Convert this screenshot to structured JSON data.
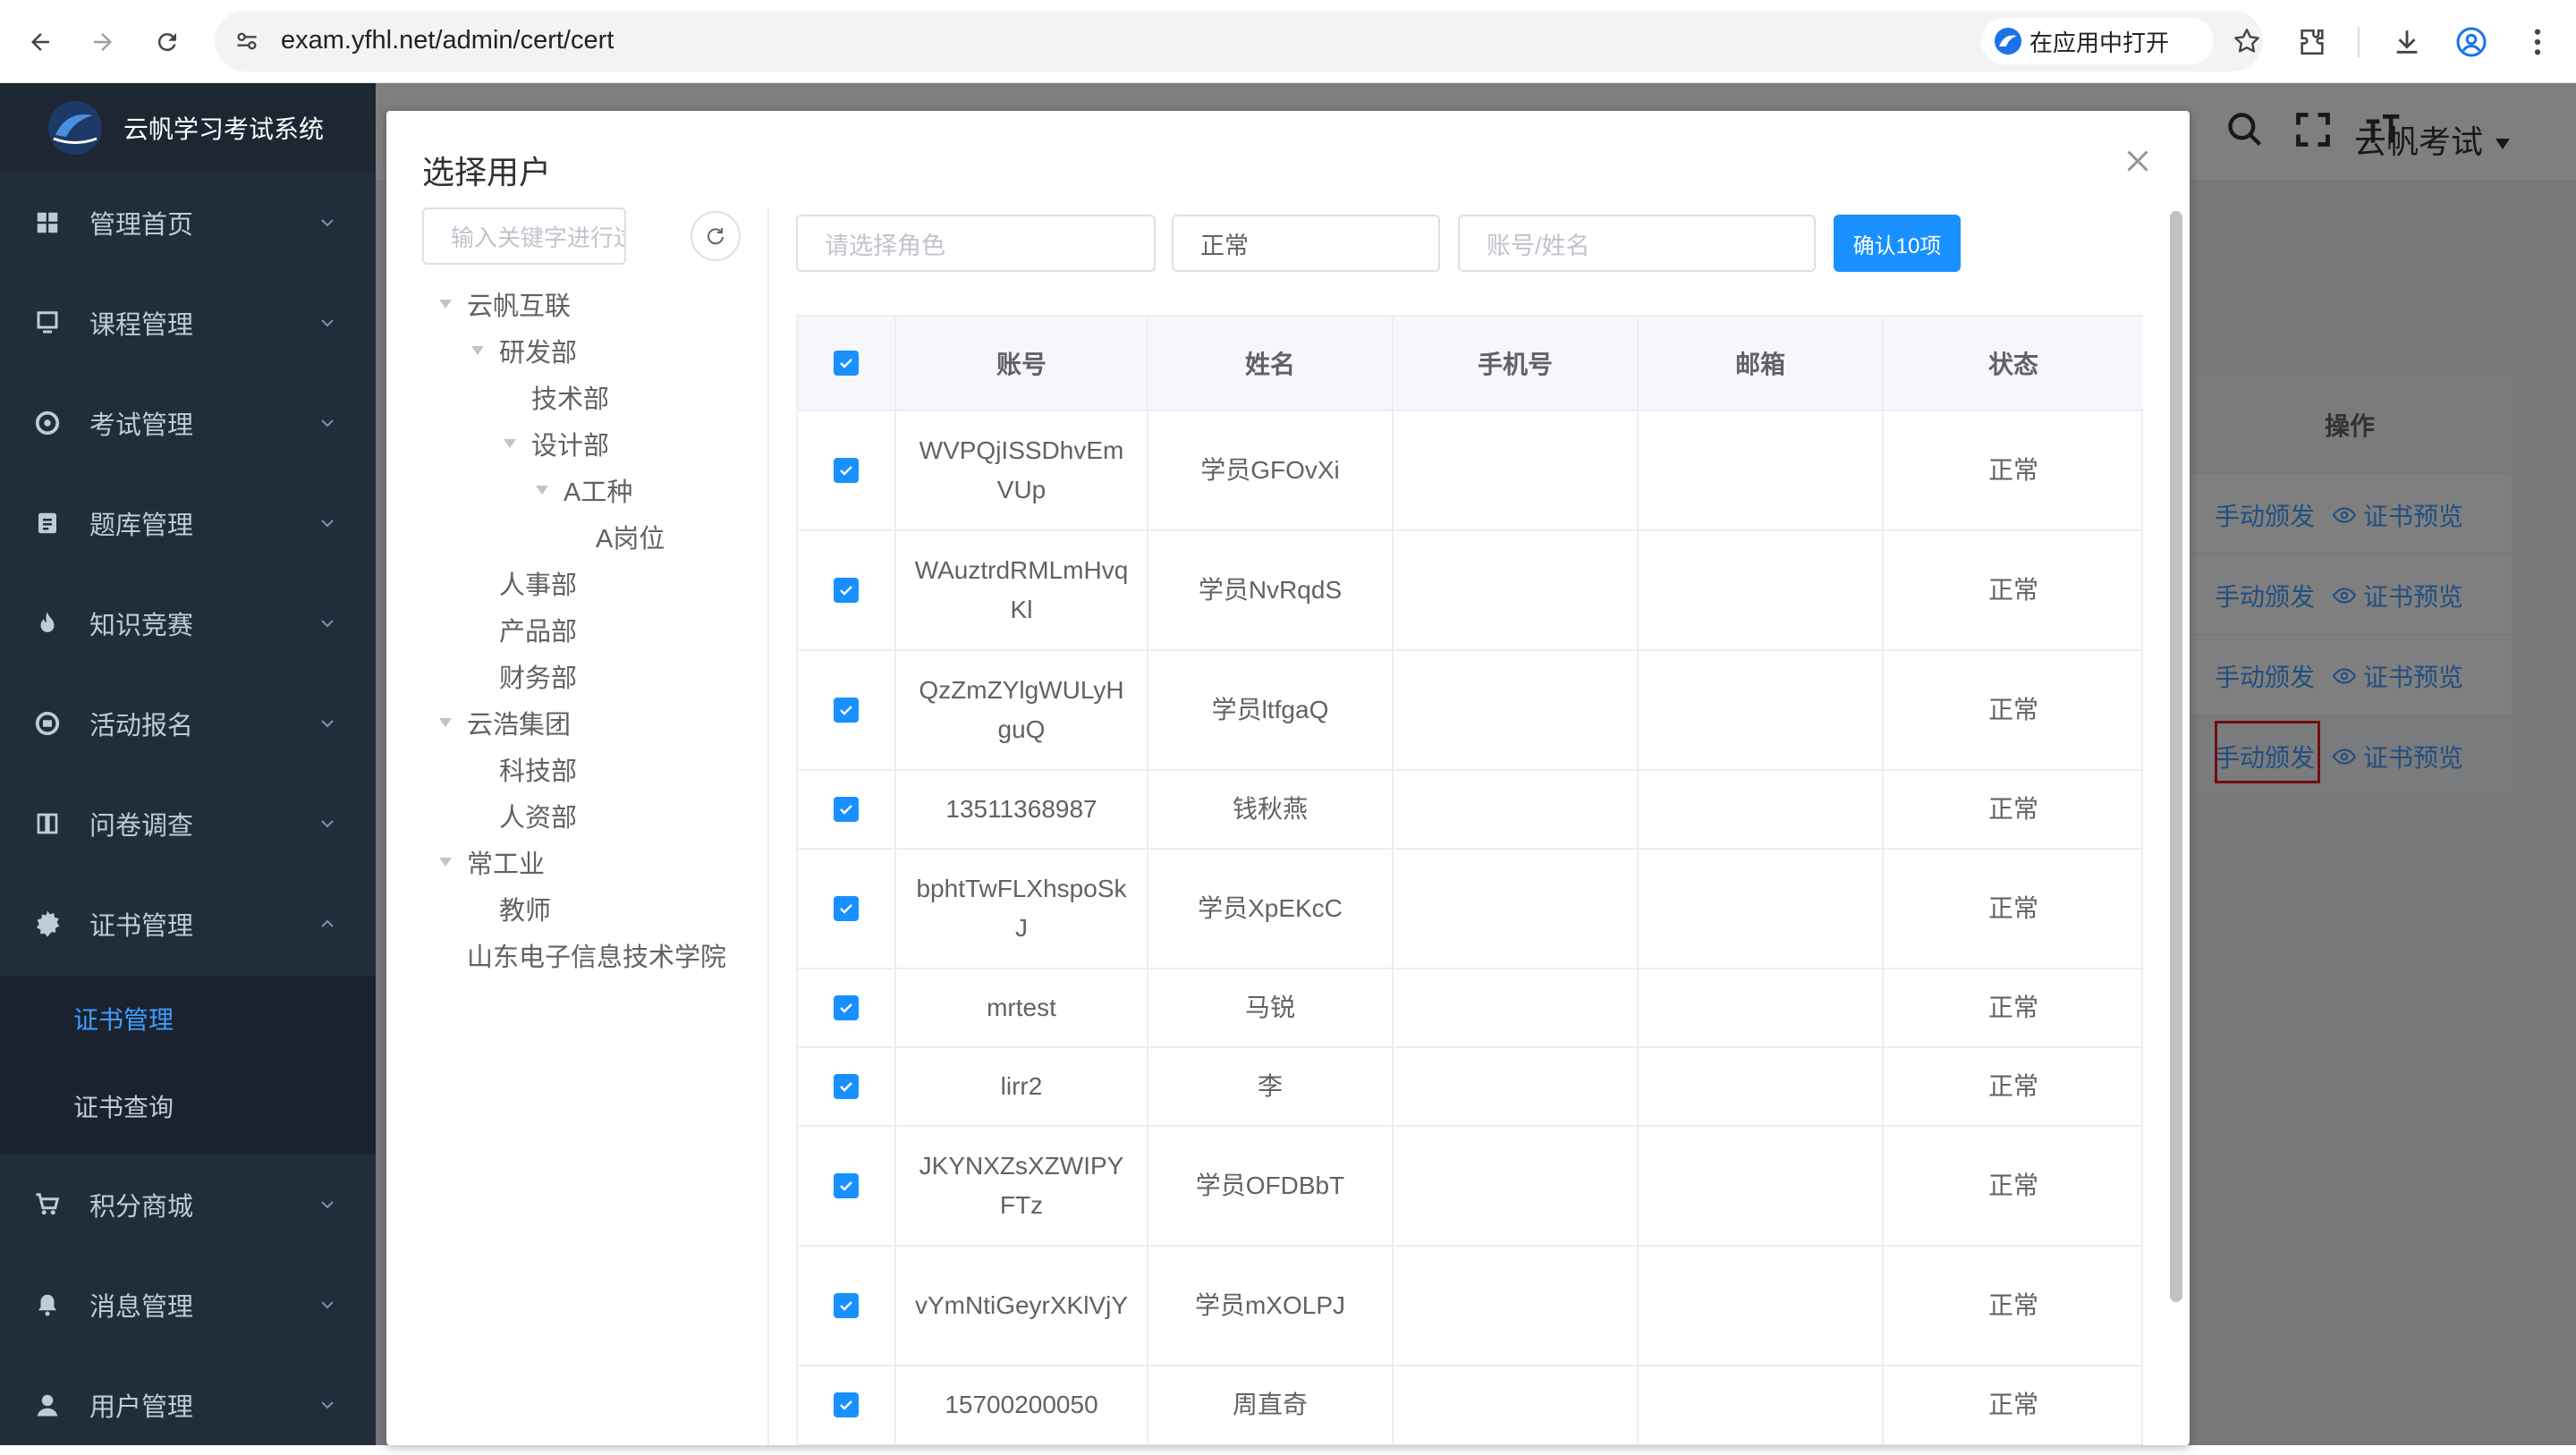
{
  "browser": {
    "url": "exam.yfhl.net/admin/cert/cert",
    "open_in_app": "在应用中打开"
  },
  "app": {
    "logo_text": "云帆学习考试系统",
    "user_name": "云帆考试"
  },
  "sidebar": {
    "items": [
      {
        "label": "管理首页",
        "icon": "dashboard-icon"
      },
      {
        "label": "课程管理",
        "icon": "monitor-icon"
      },
      {
        "label": "考试管理",
        "icon": "aperture-icon"
      },
      {
        "label": "题库管理",
        "icon": "document-icon"
      },
      {
        "label": "知识竞赛",
        "icon": "fire-icon"
      },
      {
        "label": "活动报名",
        "icon": "activity-icon"
      },
      {
        "label": "问卷调查",
        "icon": "book-icon"
      },
      {
        "label": "证书管理",
        "icon": "gear-icon"
      },
      {
        "label": "积分商城",
        "icon": "cart-icon"
      },
      {
        "label": "消息管理",
        "icon": "bell-icon"
      },
      {
        "label": "用户管理",
        "icon": "user-icon"
      }
    ],
    "submenu": [
      "证书管理",
      "证书查询"
    ]
  },
  "background_table": {
    "ops_header": "操作",
    "manual_issue": "手动颁发",
    "preview": "证书预览"
  },
  "dialog": {
    "title": "选择用户",
    "tree_filter_placeholder": "输入关键字进行过滤",
    "tree": [
      {
        "label": "云帆互联",
        "expanded": true
      },
      {
        "label": "研发部",
        "expanded": true
      },
      {
        "label": "技术部"
      },
      {
        "label": "设计部",
        "expanded": true
      },
      {
        "label": "A工种",
        "expanded": true
      },
      {
        "label": "A岗位"
      },
      {
        "label": "人事部"
      },
      {
        "label": "产品部"
      },
      {
        "label": "财务部"
      },
      {
        "label": "云浩集团",
        "expanded": true
      },
      {
        "label": "科技部"
      },
      {
        "label": "人资部"
      },
      {
        "label": "常工业",
        "expanded": true
      },
      {
        "label": "教师"
      },
      {
        "label": "山东电子信息技术学院"
      }
    ],
    "role_placeholder": "请选择角色",
    "status_value": "正常",
    "search_placeholder": "账号/姓名",
    "confirm_label": "确认10项",
    "columns": [
      "账号",
      "姓名",
      "手机号",
      "邮箱",
      "状态"
    ],
    "rows": [
      {
        "account": "WVPQjISSDhvEmVUp",
        "name": "学员GFOvXi",
        "phone": "",
        "email": "",
        "status": "正常"
      },
      {
        "account": "WAuztrdRMLmHvqKl",
        "name": "学员NvRqdS",
        "phone": "",
        "email": "",
        "status": "正常"
      },
      {
        "account": "QzZmZYlgWULyHguQ",
        "name": "学员ltfgaQ",
        "phone": "",
        "email": "",
        "status": "正常"
      },
      {
        "account": "13511368987",
        "name": "钱秋燕",
        "phone": "",
        "email": "",
        "status": "正常"
      },
      {
        "account": "bphtTwFLXhspoSkJ",
        "name": "学员XpEKcC",
        "phone": "",
        "email": "",
        "status": "正常"
      },
      {
        "account": "mrtest",
        "name": "马锐",
        "phone": "",
        "email": "",
        "status": "正常"
      },
      {
        "account": "lirr2",
        "name": "李",
        "phone": "",
        "email": "",
        "status": "正常"
      },
      {
        "account": "JKYNXZsXZWIPYFTz",
        "name": "学员OFDBbT",
        "phone": "",
        "email": "",
        "status": "正常"
      },
      {
        "account": "vYmNtiGeyrXKlVjY",
        "name": "学员mXOLPJ",
        "phone": "",
        "email": "",
        "status": "正常"
      },
      {
        "account": "15700200050",
        "name": "周直奇",
        "phone": "",
        "email": "",
        "status": "正常"
      }
    ]
  },
  "colors": {
    "sidebar_bg": "#222d3b",
    "accent": "#1890ff",
    "link": "#409eff",
    "highlight_border": "#e02020"
  }
}
